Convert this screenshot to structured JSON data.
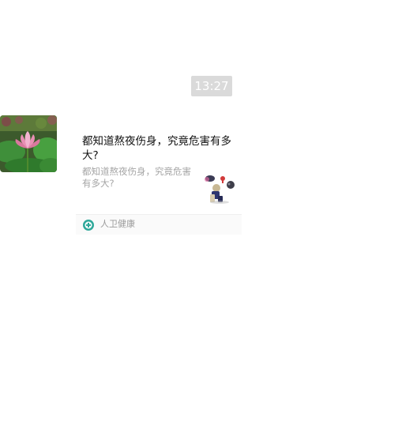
{
  "chat": {
    "timestamp": "13:27"
  },
  "message": {
    "avatar_icon": "lotus-photo-avatar",
    "title": "都知道熬夜伤身，究竟危害有多大?",
    "description": "都知道熬夜伤身，究竟危害有多大?",
    "thumbnail_icon": "staying-up-late-illustration",
    "source": {
      "name": "人卫健康",
      "icon": "renwei-health-logo-icon",
      "brand_color": "#2fa89a"
    }
  }
}
